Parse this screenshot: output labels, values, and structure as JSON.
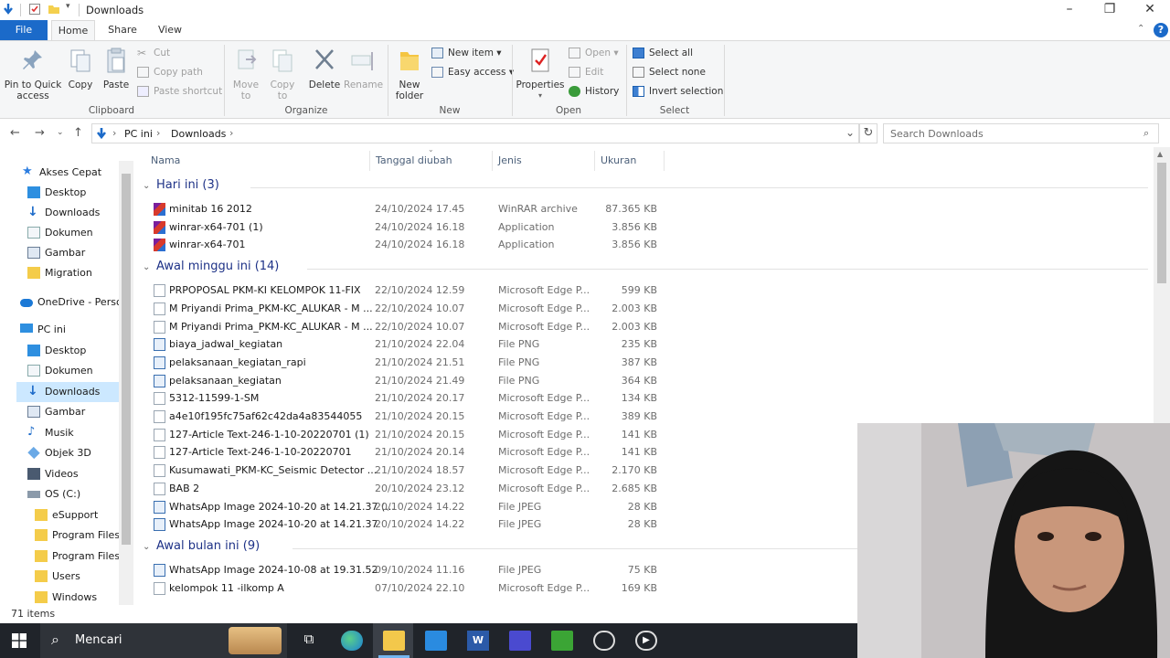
{
  "window": {
    "title": "Downloads"
  },
  "tabs": [
    {
      "label": "File"
    },
    {
      "label": "Home"
    },
    {
      "label": "Share"
    },
    {
      "label": "View"
    }
  ],
  "ribbon": {
    "pin_label": "Pin to Quick access",
    "copy_label": "Copy",
    "paste_label": "Paste",
    "cut_label": "Cut",
    "copy_path_label": "Copy path",
    "paste_shortcut_label": "Paste shortcut",
    "clipboard_group": "Clipboard",
    "move_to_label": "Move to",
    "copy_to_label": "Copy to",
    "delete_label": "Delete",
    "rename_label": "Rename",
    "organize_group": "Organize",
    "new_folder_label": "New folder",
    "new_item_label": "New item",
    "easy_access_label": "Easy access",
    "new_group": "New",
    "properties_label": "Properties",
    "open_label": "Open",
    "edit_label": "Edit",
    "history_label": "History",
    "open_group": "Open",
    "select_all_label": "Select all",
    "select_none_label": "Select none",
    "invert_selection_label": "Invert selection",
    "select_group": "Select"
  },
  "address": {
    "crumbs": [
      "PC ini",
      "Downloads"
    ],
    "search_placeholder": "Search Downloads"
  },
  "nav": {
    "items": [
      {
        "label": "Akses Cepat",
        "icon": "star-icon"
      },
      {
        "label": "Desktop",
        "icon": "desktop-icon"
      },
      {
        "label": "Downloads",
        "icon": "download-icon"
      },
      {
        "label": "Dokumen",
        "icon": "document-icon"
      },
      {
        "label": "Gambar",
        "icon": "picture-icon"
      },
      {
        "label": "Migration",
        "icon": "folder-icon"
      },
      {
        "label": "OneDrive - Person",
        "icon": "cloud-icon"
      },
      {
        "label": "PC ini",
        "icon": "computer-icon"
      },
      {
        "label": "Desktop",
        "icon": "desktop-icon"
      },
      {
        "label": "Dokumen",
        "icon": "document-icon"
      },
      {
        "label": "Downloads",
        "icon": "download-icon"
      },
      {
        "label": "Gambar",
        "icon": "picture-icon"
      },
      {
        "label": "Musik",
        "icon": "music-icon"
      },
      {
        "label": "Objek 3D",
        "icon": "cube-icon"
      },
      {
        "label": "Videos",
        "icon": "video-icon"
      },
      {
        "label": "OS (C:)",
        "icon": "drive-icon"
      },
      {
        "label": "eSupport",
        "icon": "folder-icon"
      },
      {
        "label": "Program Files",
        "icon": "folder-icon"
      },
      {
        "label": "Program Files (",
        "icon": "folder-icon"
      },
      {
        "label": "Users",
        "icon": "folder-icon"
      },
      {
        "label": "Windows",
        "icon": "folder-icon"
      }
    ]
  },
  "columns": {
    "name": "Nama",
    "date": "Tanggal diubah",
    "type": "Jenis",
    "size": "Ukuran"
  },
  "groups": [
    {
      "header": "Hari ini (3)",
      "files": [
        {
          "name": "minitab 16 2012",
          "date": "24/10/2024 17.45",
          "type": "WinRAR archive",
          "size": "87.365 KB",
          "icon": "rar"
        },
        {
          "name": "winrar-x64-701 (1)",
          "date": "24/10/2024 16.18",
          "type": "Application",
          "size": "3.856 KB",
          "icon": "rar"
        },
        {
          "name": "winrar-x64-701",
          "date": "24/10/2024 16.18",
          "type": "Application",
          "size": "3.856 KB",
          "icon": "rar"
        }
      ]
    },
    {
      "header": "Awal minggu ini (14)",
      "files": [
        {
          "name": "PRPOPOSAL PKM-KI KELOMPOK 11-FIX",
          "date": "22/10/2024 12.59",
          "type": "Microsoft Edge P...",
          "size": "599 KB",
          "icon": "doc"
        },
        {
          "name": "M Priyandi Prima_PKM-KC_ALUKAR - M ...",
          "date": "22/10/2024 10.07",
          "type": "Microsoft Edge P...",
          "size": "2.003 KB",
          "icon": "doc"
        },
        {
          "name": "M Priyandi Prima_PKM-KC_ALUKAR - M ...",
          "date": "22/10/2024 10.07",
          "type": "Microsoft Edge P...",
          "size": "2.003 KB",
          "icon": "doc"
        },
        {
          "name": "biaya_jadwal_kegiatan",
          "date": "21/10/2024 22.04",
          "type": "File PNG",
          "size": "235 KB",
          "icon": "img"
        },
        {
          "name": "pelaksanaan_kegiatan_rapi",
          "date": "21/10/2024 21.51",
          "type": "File PNG",
          "size": "387 KB",
          "icon": "img"
        },
        {
          "name": "pelaksanaan_kegiatan",
          "date": "21/10/2024 21.49",
          "type": "File PNG",
          "size": "364 KB",
          "icon": "img"
        },
        {
          "name": "5312-11599-1-SM",
          "date": "21/10/2024 20.17",
          "type": "Microsoft Edge P...",
          "size": "134 KB",
          "icon": "doc"
        },
        {
          "name": "a4e10f195fc75af62c42da4a83544055",
          "date": "21/10/2024 20.15",
          "type": "Microsoft Edge P...",
          "size": "389 KB",
          "icon": "doc"
        },
        {
          "name": "127-Article Text-246-1-10-20220701 (1)",
          "date": "21/10/2024 20.15",
          "type": "Microsoft Edge P...",
          "size": "141 KB",
          "icon": "doc"
        },
        {
          "name": "127-Article Text-246-1-10-20220701",
          "date": "21/10/2024 20.14",
          "type": "Microsoft Edge P...",
          "size": "141 KB",
          "icon": "doc"
        },
        {
          "name": "Kusumawati_PKM-KC_Seismic Detector ...",
          "date": "21/10/2024 18.57",
          "type": "Microsoft Edge P...",
          "size": "2.170 KB",
          "icon": "doc"
        },
        {
          "name": "BAB 2",
          "date": "20/10/2024 23.12",
          "type": "Microsoft Edge P...",
          "size": "2.685 KB",
          "icon": "doc"
        },
        {
          "name": "WhatsApp Image 2024-10-20 at 14.21.37 (...",
          "date": "20/10/2024 14.22",
          "type": "File JPEG",
          "size": "28 KB",
          "icon": "img"
        },
        {
          "name": "WhatsApp Image 2024-10-20 at 14.21.37",
          "date": "20/10/2024 14.22",
          "type": "File JPEG",
          "size": "28 KB",
          "icon": "img"
        }
      ]
    },
    {
      "header": "Awal bulan ini (9)",
      "files": [
        {
          "name": "WhatsApp Image 2024-10-08 at 19.31.52",
          "date": "09/10/2024 11.16",
          "type": "File JPEG",
          "size": "75 KB",
          "icon": "img"
        },
        {
          "name": "kelompok 11 -ilkomp A",
          "date": "07/10/2024 22.10",
          "type": "Microsoft Edge P...",
          "size": "169 KB",
          "icon": "doc"
        }
      ]
    }
  ],
  "status": {
    "items_count": "71 items"
  },
  "taskbar": {
    "search_text": "Mencari"
  }
}
